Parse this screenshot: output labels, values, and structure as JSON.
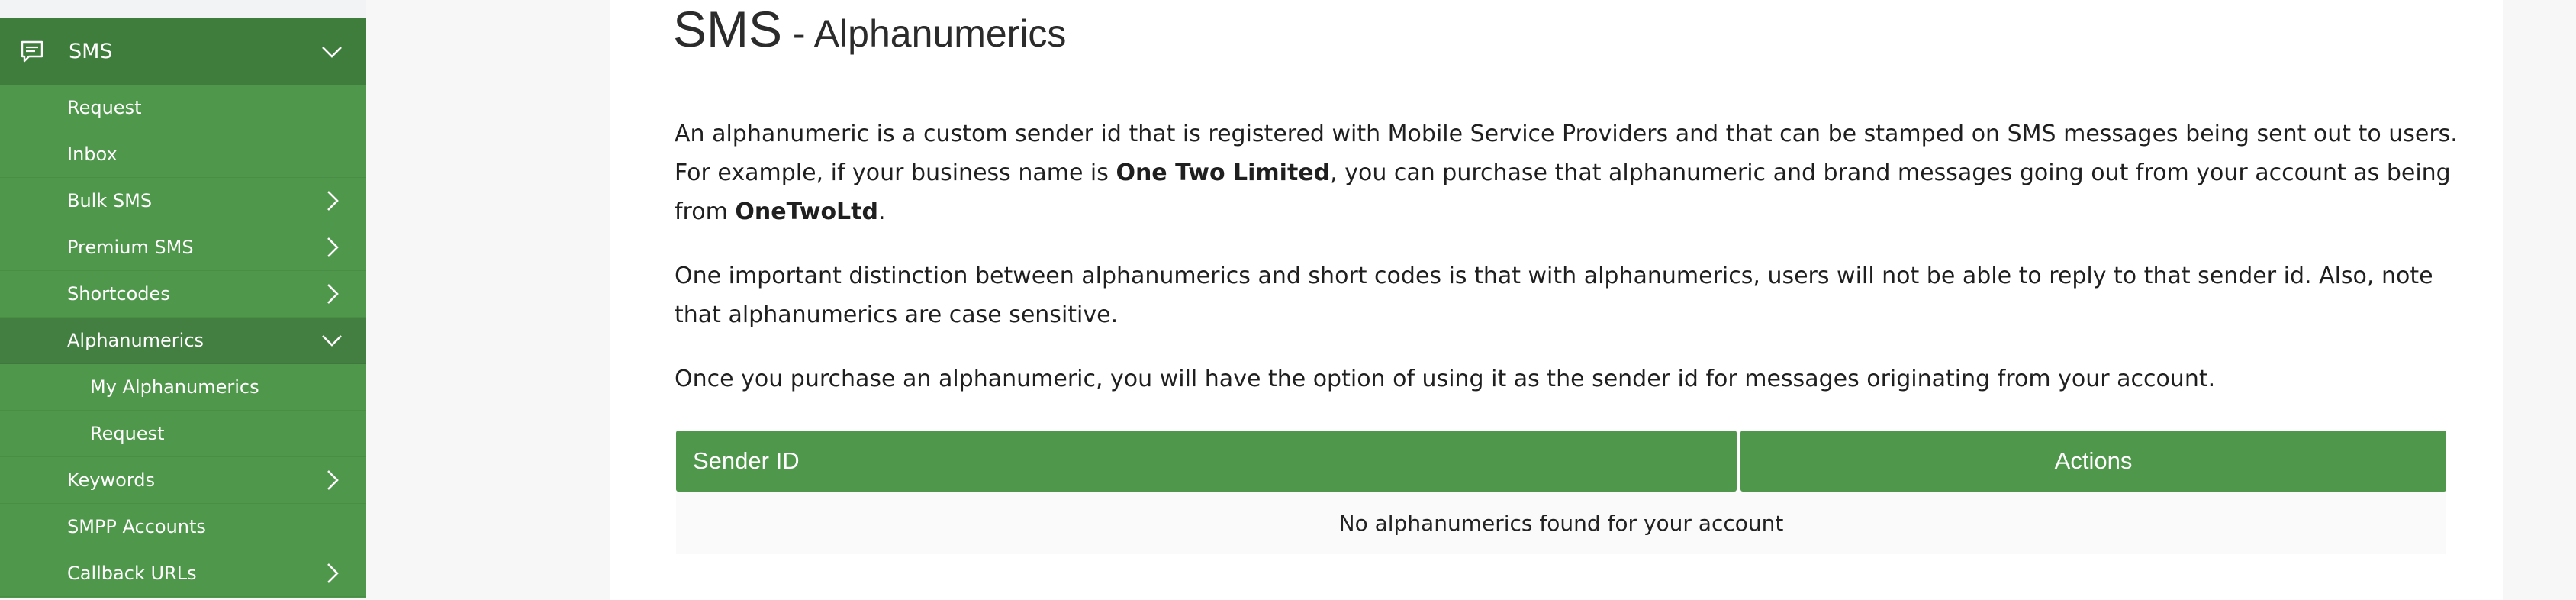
{
  "sidebar": {
    "header": {
      "label": "SMS",
      "icon": "message-icon"
    },
    "items": [
      {
        "label": "Request"
      },
      {
        "label": "Inbox"
      },
      {
        "label": "Bulk SMS"
      },
      {
        "label": "Premium SMS"
      },
      {
        "label": "Shortcodes"
      },
      {
        "label": "Alphanumerics"
      },
      {
        "label": "My Alphanumerics"
      },
      {
        "label": "Request"
      },
      {
        "label": "Keywords"
      },
      {
        "label": "SMPP Accounts"
      },
      {
        "label": "Callback URLs"
      }
    ]
  },
  "page": {
    "title_main": "SMS",
    "title_sep": " - ",
    "title_sub": "Alphanumerics",
    "para1": {
      "t1": "An alphanumeric is a custom sender id that is registered with Mobile Service Providers and that can be stamped on SMS messages being sent out to users. For example, if your business name is ",
      "b1": "One Two Limited",
      "t2": ", you can purchase that alphanumeric and brand messages going out from your account as being from ",
      "b2": "OneTwoLtd",
      "t3": "."
    },
    "para2": "One important distinction between alphanumerics and short codes is that with alphanumerics, users will not be able to reply to that sender id. Also, note that alphanumerics are case sensitive.",
    "para3": "Once you purchase an alphanumeric, you will have the option of using it as the sender id for messages originating from your account."
  },
  "table": {
    "headers": [
      "Sender ID",
      "Actions"
    ],
    "empty_message": "No alphanumerics found for your account"
  },
  "colors": {
    "sidebar_bg": "#4f974b",
    "sidebar_header_bg": "#3f7d3d",
    "table_header_bg": "#4f974b"
  }
}
